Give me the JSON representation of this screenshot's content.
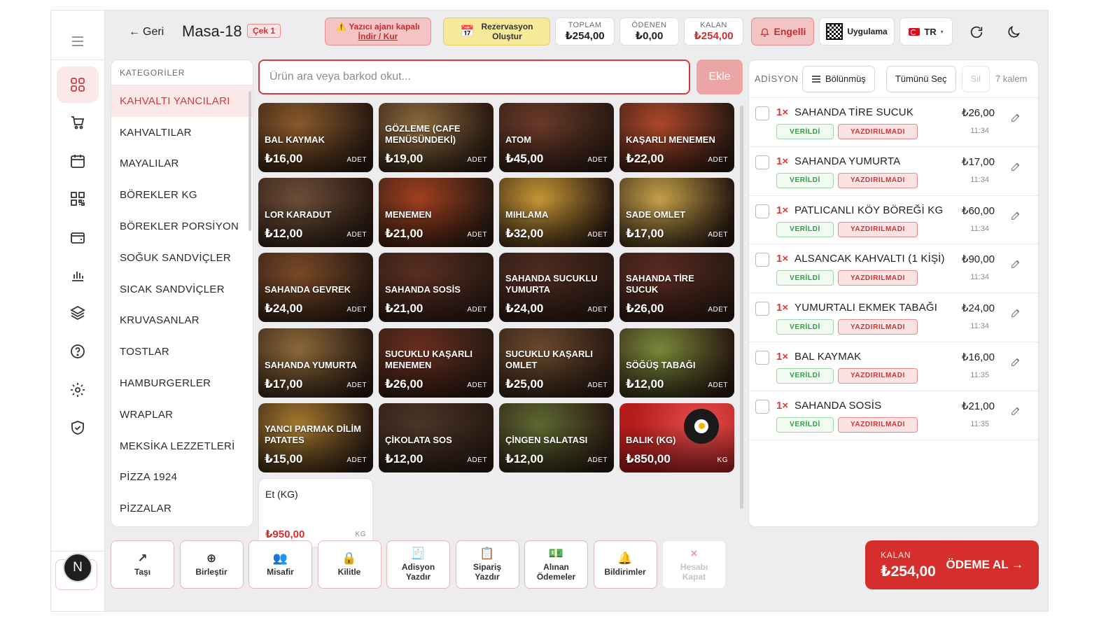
{
  "header": {
    "back_label": "Geri",
    "table_name": "Masa-18",
    "check_badge": "Çek 1",
    "printer_warning": "Yazıcı ajanı kapalı",
    "printer_link": "İndir / Kur",
    "reservation_line1": "Rezervasyon",
    "reservation_line2": "Oluştur",
    "total_label": "TOPLAM",
    "total_value": "₺254,00",
    "paid_label": "ÖDENEN",
    "paid_value": "₺0,00",
    "remaining_label": "KALAN",
    "remaining_value": "₺254,00",
    "engelli_label": "Engelli",
    "app_label": "Uygulama",
    "lang_label": "TR",
    "lang_caret": "▾"
  },
  "rail": {
    "icons": [
      "menu-icon",
      "grid-icon",
      "cart-icon",
      "calendar-icon",
      "qr-icon",
      "wallet-icon",
      "chart-icon",
      "layers-icon",
      "help-icon",
      "settings-icon",
      "shield-icon"
    ],
    "avatar_letter": "N"
  },
  "categories": {
    "header": "KATEGORİLER",
    "items": [
      "KAHVALTI YANCILARI",
      "KAHVALTILAR",
      "MAYALILAR",
      "BÖREKLER KG",
      "BÖREKLER PORSİYON",
      "SOĞUK SANDVİÇLER",
      "SICAK SANDVİÇLER",
      "KRUVASANLAR",
      "TOSTLAR",
      "HAMBURGERLER",
      "WRAPLAR",
      "MEKSİKA LEZZETLERİ",
      "PİZZA 1924",
      "PİZZALAR"
    ],
    "active_index": 0
  },
  "search": {
    "placeholder": "Ürün ara veya barkod okut...",
    "value": "",
    "add_label": "Ekle"
  },
  "products": [
    {
      "name": "BAL KAYMAK",
      "price": "₺16,00",
      "unit": "ADET",
      "color": "#8a5a2b"
    },
    {
      "name": "GÖZLEME (CAFE MENÜSÜNDEKİ)",
      "price": "₺19,00",
      "unit": "ADET",
      "color": "#8b6a3e"
    },
    {
      "name": "ATOM",
      "price": "₺45,00",
      "unit": "ADET",
      "color": "#6b3a2a"
    },
    {
      "name": "KAŞARLI MENEMEN",
      "price": "₺22,00",
      "unit": "ADET",
      "color": "#b0472a"
    },
    {
      "name": "LOR KARADUT",
      "price": "₺12,00",
      "unit": "ADET",
      "color": "#6e4e3a"
    },
    {
      "name": "MENEMEN",
      "price": "₺21,00",
      "unit": "ADET",
      "color": "#a3401f"
    },
    {
      "name": "MIHLAMA",
      "price": "₺32,00",
      "unit": "ADET",
      "color": "#c99836"
    },
    {
      "name": "SADE OMLET",
      "price": "₺17,00",
      "unit": "ADET",
      "color": "#c7a34a"
    },
    {
      "name": "SAHANDA GEVREK",
      "price": "₺24,00",
      "unit": "ADET",
      "color": "#7a4a26"
    },
    {
      "name": "SAHANDA SOSİS",
      "price": "₺21,00",
      "unit": "ADET",
      "color": "#5a2e22"
    },
    {
      "name": "SAHANDA SUCUKLU YUMURTA",
      "price": "₺24,00",
      "unit": "ADET",
      "color": "#4e2b22"
    },
    {
      "name": "SAHANDA TİRE SUCUK",
      "price": "₺26,00",
      "unit": "ADET",
      "color": "#5b2a22"
    },
    {
      "name": "SAHANDA YUMURTA",
      "price": "₺17,00",
      "unit": "ADET",
      "color": "#8e6a3a"
    },
    {
      "name": "SUCUKLU KAŞARLI MENEMEN",
      "price": "₺26,00",
      "unit": "ADET",
      "color": "#6a2e1f"
    },
    {
      "name": "SUCUKLU KAŞARLI OMLET",
      "price": "₺25,00",
      "unit": "ADET",
      "color": "#6b4a2e"
    },
    {
      "name": "SÖĞÜŞ TABAĞI",
      "price": "₺12,00",
      "unit": "ADET",
      "color": "#7a8a3a"
    },
    {
      "name": "YANCI PARMAK DİLİM PATATES",
      "price": "₺15,00",
      "unit": "ADET",
      "color": "#a67a2e"
    },
    {
      "name": "ÇİKOLATA SOS",
      "price": "₺12,00",
      "unit": "ADET",
      "color": "#4a3628"
    },
    {
      "name": "ÇİNGEN SALATASI",
      "price": "₺12,00",
      "unit": "ADET",
      "color": "#5e6a32"
    },
    {
      "name": "Balık (KG)",
      "price": "₺850,00",
      "unit": "KG",
      "color": "#c42a2a"
    },
    {
      "name": "Et (KG)",
      "price": "₺950,00",
      "unit": "KG",
      "color": "#ffffff"
    }
  ],
  "order": {
    "label": "ADİSYON",
    "split_label": "Bölünmüş",
    "select_all_label": "Tümünü Seç",
    "delete_label": "Sil",
    "count_label": "7 kalem",
    "served_label": "VERİLDİ",
    "not_printed_label": "YAZDIRILMADI",
    "lines": [
      {
        "qty": "1×",
        "name": "SAHANDA TİRE SUCUK",
        "price": "₺26,00",
        "time": "11:34"
      },
      {
        "qty": "1×",
        "name": "SAHANDA YUMURTA",
        "price": "₺17,00",
        "time": "11:34"
      },
      {
        "qty": "1×",
        "name": "PATLICANLI KÖY BÖREĞİ KG",
        "price": "₺60,00",
        "time": "11:34"
      },
      {
        "qty": "1×",
        "name": "ALSANCAK KAHVALTI (1 KİŞİ)",
        "price": "₺90,00",
        "time": "11:34"
      },
      {
        "qty": "1×",
        "name": "YUMURTALI EKMEK TABAĞI",
        "price": "₺24,00",
        "time": "11:34"
      },
      {
        "qty": "1×",
        "name": "BAL KAYMAK",
        "price": "₺16,00",
        "time": "11:35"
      },
      {
        "qty": "1×",
        "name": "SAHANDA SOSİS",
        "price": "₺21,00",
        "time": "11:35"
      }
    ]
  },
  "bottom": {
    "buttons": [
      {
        "l1": "Taşı",
        "l2": "",
        "icon": "↗",
        "name": "move-table-button",
        "disabled": false
      },
      {
        "l1": "Birleştir",
        "l2": "",
        "icon": "⊕",
        "name": "merge-button",
        "disabled": false
      },
      {
        "l1": "Misafir",
        "l2": "",
        "icon": "👥",
        "name": "guest-button",
        "disabled": false
      },
      {
        "l1": "Kilitle",
        "l2": "",
        "icon": "🔒",
        "name": "lock-button",
        "disabled": false
      },
      {
        "l1": "Adisyon",
        "l2": "Yazdır",
        "icon": "🧾",
        "name": "print-check-button",
        "disabled": false
      },
      {
        "l1": "Sipariş",
        "l2": "Yazdır",
        "icon": "📋",
        "name": "print-order-button",
        "disabled": false
      },
      {
        "l1": "Alınan",
        "l2": "Ödemeler",
        "icon": "💵",
        "name": "payments-received-button",
        "disabled": false
      },
      {
        "l1": "Bildirimler",
        "l2": "",
        "icon": "🔔",
        "name": "notifications-button",
        "disabled": false
      },
      {
        "l1": "Hesabı",
        "l2": "Kapat",
        "icon": "×",
        "name": "close-account-button",
        "disabled": true
      }
    ],
    "pay_label": "KALAN",
    "pay_value": "₺254,00",
    "pay_cta": "ÖDEME AL →"
  }
}
